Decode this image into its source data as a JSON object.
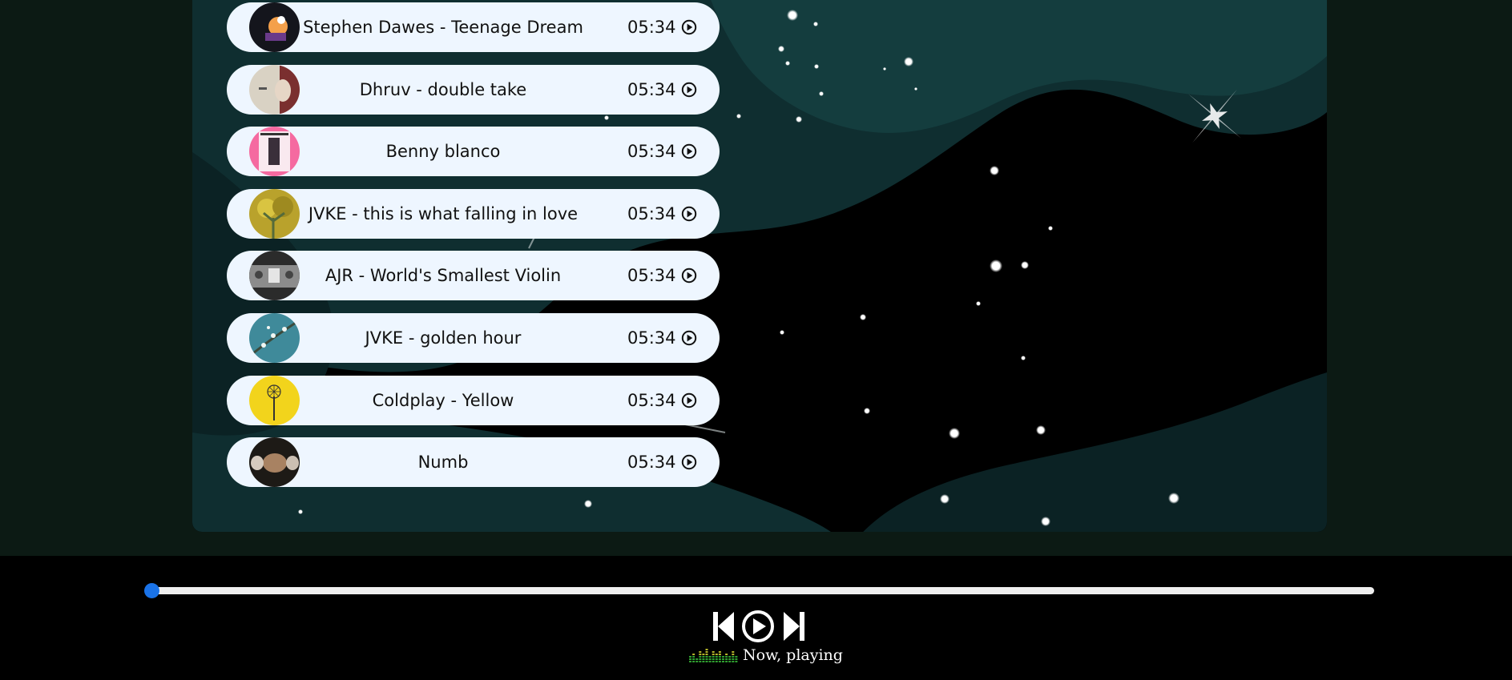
{
  "playlist": {
    "songs": [
      {
        "title": "Stephen Dawes - Teenage Dream",
        "duration": "05:34",
        "cover": "dark-concert-art"
      },
      {
        "title": "Dhruv - double take",
        "duration": "05:34",
        "cover": "beige-portrait-art"
      },
      {
        "title": "Benny blanco",
        "duration": "05:34",
        "cover": "pink-frame-art"
      },
      {
        "title": "JVKE - this is what falling in love",
        "duration": "05:34",
        "cover": "yellow-tree-art"
      },
      {
        "title": "AJR - World's Smallest Violin",
        "duration": "05:34",
        "cover": "grey-photo-art"
      },
      {
        "title": "JVKE - golden hour",
        "duration": "05:34",
        "cover": "teal-blossom-art"
      },
      {
        "title": "Coldplay - Yellow",
        "duration": "05:34",
        "cover": "yellow-star-art"
      },
      {
        "title": "Numb",
        "duration": "05:34",
        "cover": "dark-face-art"
      }
    ]
  },
  "player": {
    "progress": 0,
    "now_playing_label": "Now, playing",
    "accent_color": "#1a73e8",
    "equalizer_colors": [
      "#2f9e2f",
      "#b5b52a"
    ]
  },
  "icons": {
    "play": "play-circle-icon",
    "previous": "skip-previous-icon",
    "next": "skip-next-icon",
    "equalizer": "equalizer-icon"
  }
}
